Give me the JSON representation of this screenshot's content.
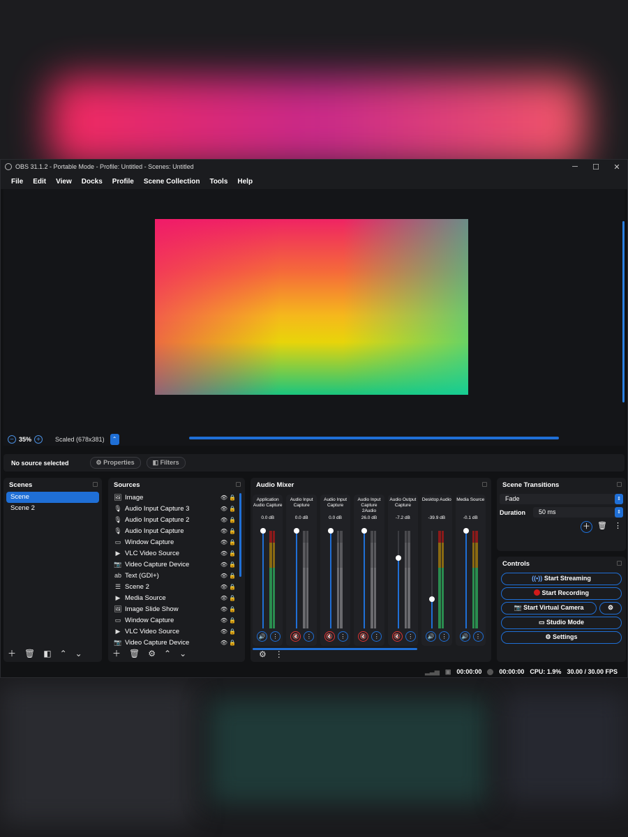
{
  "window": {
    "title": "OBS 31.1.2 - Portable Mode - Profile: Untitled - Scenes: Untitled",
    "min": "─",
    "max": "☐",
    "close": "✕"
  },
  "menu": [
    "File",
    "Edit",
    "View",
    "Docks",
    "Profile",
    "Scene Collection",
    "Tools",
    "Help"
  ],
  "preview": {
    "zoom": "35%",
    "scale": "Scaled (678x381)"
  },
  "source_bar": {
    "status": "No source selected",
    "properties": "Properties",
    "filters": "Filters"
  },
  "scenes": {
    "title": "Scenes",
    "items": [
      "Scene",
      "Scene 2"
    ],
    "selected": 0
  },
  "sources": {
    "title": "Sources",
    "items": [
      {
        "icon": "image-icon",
        "glyph": "🖼",
        "name": "Image",
        "locked": true
      },
      {
        "icon": "mic-icon",
        "glyph": "🎙",
        "name": "Audio Input Capture 3",
        "locked": true
      },
      {
        "icon": "mic-icon",
        "glyph": "🎙",
        "name": "Audio Input Capture 2",
        "locked": true
      },
      {
        "icon": "mic-icon",
        "glyph": "🎙",
        "name": "Audio Input Capture",
        "locked": true
      },
      {
        "icon": "window-icon",
        "glyph": "▭",
        "name": "Window Capture",
        "locked": true
      },
      {
        "icon": "play-icon",
        "glyph": "▶",
        "name": "VLC Video Source",
        "locked": true
      },
      {
        "icon": "camera-icon",
        "glyph": "📷",
        "name": "Video Capture Device",
        "locked": true
      },
      {
        "icon": "text-icon",
        "glyph": "ab",
        "name": "Text (GDI+)",
        "locked": false
      },
      {
        "icon": "list-icon",
        "glyph": "☰",
        "name": "Scene 2",
        "locked": false
      },
      {
        "icon": "play-icon",
        "glyph": "▶",
        "name": "Media Source",
        "locked": false
      },
      {
        "icon": "slideshow-icon",
        "glyph": "🖼",
        "name": "Image Slide Show",
        "locked": false
      },
      {
        "icon": "window-icon",
        "glyph": "▭",
        "name": "Window Capture",
        "locked": false
      },
      {
        "icon": "play-icon",
        "glyph": "▶",
        "name": "VLC Video Source",
        "locked": false
      },
      {
        "icon": "camera-icon",
        "glyph": "📷",
        "name": "Video Capture Device",
        "locked": false
      }
    ]
  },
  "mixer": {
    "title": "Audio Mixer",
    "channels": [
      {
        "name": "Application Audio Capture",
        "db": "0.0 dB",
        "level": 1.0,
        "muted": false,
        "active": true
      },
      {
        "name": "Audio Input Capture",
        "db": "0.0 dB",
        "level": 1.0,
        "muted": true,
        "active": false
      },
      {
        "name": "Audio Input Capture",
        "db": "0.0 dB",
        "level": 1.0,
        "muted": true,
        "active": false
      },
      {
        "name": "Audio Input Capture 2Audio",
        "db": "26.0 dB",
        "level": 1.0,
        "muted": true,
        "active": false
      },
      {
        "name": "Audio Output Capture",
        "db": "-7.2 dB",
        "level": 0.72,
        "muted": true,
        "active": false
      },
      {
        "name": "Desktop Audio",
        "db": "-39.9 dB",
        "level": 0.3,
        "muted": false,
        "active": true
      },
      {
        "name": "Media Source",
        "db": "-0.1 dB",
        "level": 1.0,
        "muted": false,
        "active": true
      }
    ]
  },
  "transitions": {
    "title": "Scene Transitions",
    "type": "Fade",
    "duration_label": "Duration",
    "duration": "50 ms"
  },
  "controls": {
    "title": "Controls",
    "start_streaming": "Start Streaming",
    "start_recording": "Start Recording",
    "start_virtual_camera": "Start Virtual Camera",
    "studio_mode": "Studio Mode",
    "settings": "Settings"
  },
  "status": {
    "stream_time": "00:00:00",
    "rec_time": "00:00:00",
    "cpu": "CPU: 1.9%",
    "fps": "30.00 / 30.00 FPS"
  },
  "colors": {
    "accent": "#1f6fd6",
    "muted": "#d33333",
    "record": "#d11a1a"
  }
}
